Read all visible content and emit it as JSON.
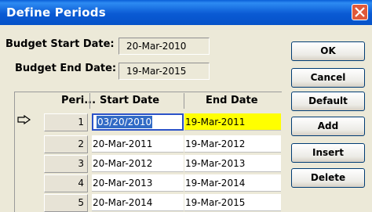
{
  "window": {
    "title": "Define Periods"
  },
  "budget": {
    "start_label": "Budget Start Date:",
    "start_value": "20-Mar-2010",
    "end_label": "Budget End Date:",
    "end_value": "19-Mar-2015"
  },
  "buttons": {
    "ok": "OK",
    "cancel": "Cancel",
    "default": "Default",
    "add": "Add",
    "insert": "Insert",
    "delete": "Delete"
  },
  "grid": {
    "headers": {
      "period": "Peri...",
      "start": "Start Date",
      "end": "End Date"
    },
    "rows": [
      {
        "period": "1",
        "start": "03/20/2010",
        "end": "19-Mar-2011"
      },
      {
        "period": "2",
        "start": "20-Mar-2011",
        "end": "19-Mar-2012"
      },
      {
        "period": "3",
        "start": "20-Mar-2012",
        "end": "19-Mar-2013"
      },
      {
        "period": "4",
        "start": "20-Mar-2013",
        "end": "19-Mar-2014"
      },
      {
        "period": "5",
        "start": "20-Mar-2014",
        "end": "19-Mar-2015"
      }
    ]
  },
  "colors": {
    "title_bar": "#0A5AD4",
    "selection": "#316AC5",
    "highlight": "#FFFF00",
    "close_button": "#E0593A"
  }
}
